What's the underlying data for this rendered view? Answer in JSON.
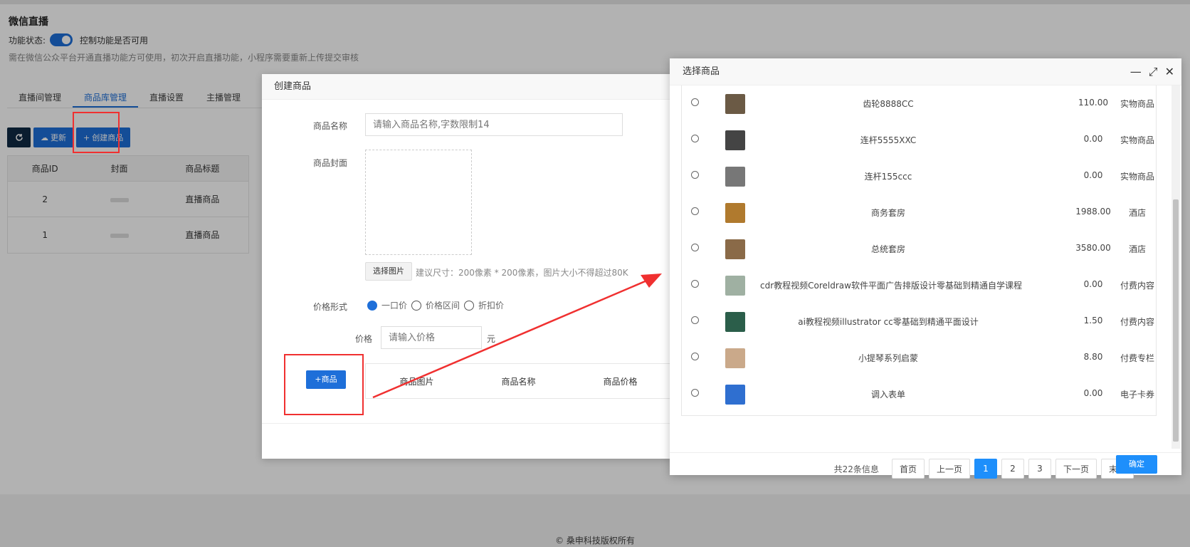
{
  "page": {
    "title": "微信直播",
    "status_label": "功能状态:",
    "status_desc": "控制功能是否可用",
    "note": "需在微信公众平台开通直播功能方可使用，初次开启直播功能，小程序需要重新上传提交审核",
    "tabs": [
      {
        "label": "直播间管理"
      },
      {
        "label": "商品库管理"
      },
      {
        "label": "直播设置"
      },
      {
        "label": "主播管理"
      }
    ],
    "toolbar": {
      "refresh_icon": "refresh-icon",
      "update_label": "更新",
      "create_label": "创建商品"
    },
    "table": {
      "headers": [
        "商品ID",
        "封面",
        "商品标题"
      ],
      "rows": [
        {
          "id": "2",
          "title": "直播商品"
        },
        {
          "id": "1",
          "title": "直播商品"
        }
      ]
    },
    "footer": "© 桑申科技版权所有"
  },
  "create_dialog": {
    "title": "创建商品",
    "name_label": "商品名称",
    "name_placeholder": "请输入商品名称,字数限制14",
    "cover_label": "商品封面",
    "choose_image": "选择图片",
    "size_hint": "建议尺寸：200像素 * 200像素，图片大小不得超过80K",
    "price_form_label": "价格形式",
    "price_options": [
      "一口价",
      "价格区间",
      "折扣价"
    ],
    "price_label": "价格",
    "price_placeholder": "请输入价格",
    "price_unit": "元",
    "add_product": "商品",
    "product_columns": [
      "商品图片",
      "商品名称",
      "商品价格"
    ]
  },
  "select_dialog": {
    "title": "选择商品",
    "items": [
      {
        "name": "齿轮8888CC",
        "price": "110.00",
        "type": "实物商品",
        "thumb": "#6b5a45"
      },
      {
        "name": "连杆5555XXC",
        "price": "0.00",
        "type": "实物商品",
        "thumb": "#444444"
      },
      {
        "name": "连杆155ccc",
        "price": "0.00",
        "type": "实物商品",
        "thumb": "#777777"
      },
      {
        "name": "商务套房",
        "price": "1988.00",
        "type": "酒店",
        "thumb": "#b07a2e"
      },
      {
        "name": "总统套房",
        "price": "3580.00",
        "type": "酒店",
        "thumb": "#8a6a48"
      },
      {
        "name": "cdr教程视频Coreldraw软件平面广告排版设计零基础到精通自学课程",
        "price": "0.00",
        "type": "付费内容",
        "thumb": "#9fb0a2"
      },
      {
        "name": "ai教程视频illustrator cc零基础到精通平面设计",
        "price": "1.50",
        "type": "付费内容",
        "thumb": "#2b5e4a"
      },
      {
        "name": "小提琴系列启蒙",
        "price": "8.80",
        "type": "付费专栏",
        "thumb": "#caa98a"
      },
      {
        "name": "调入表单",
        "price": "0.00",
        "type": "电子卡券",
        "thumb": "#2f6fd0"
      }
    ],
    "total": "共22条信息",
    "pager": [
      "首页",
      "上一页",
      "1",
      "2",
      "3",
      "下一页",
      "末页"
    ],
    "active_page": "1",
    "confirm": "确定"
  },
  "colors": {
    "primary": "#1e6fd9",
    "pager_active": "#1e8ffb",
    "annotation": "#f03030"
  }
}
